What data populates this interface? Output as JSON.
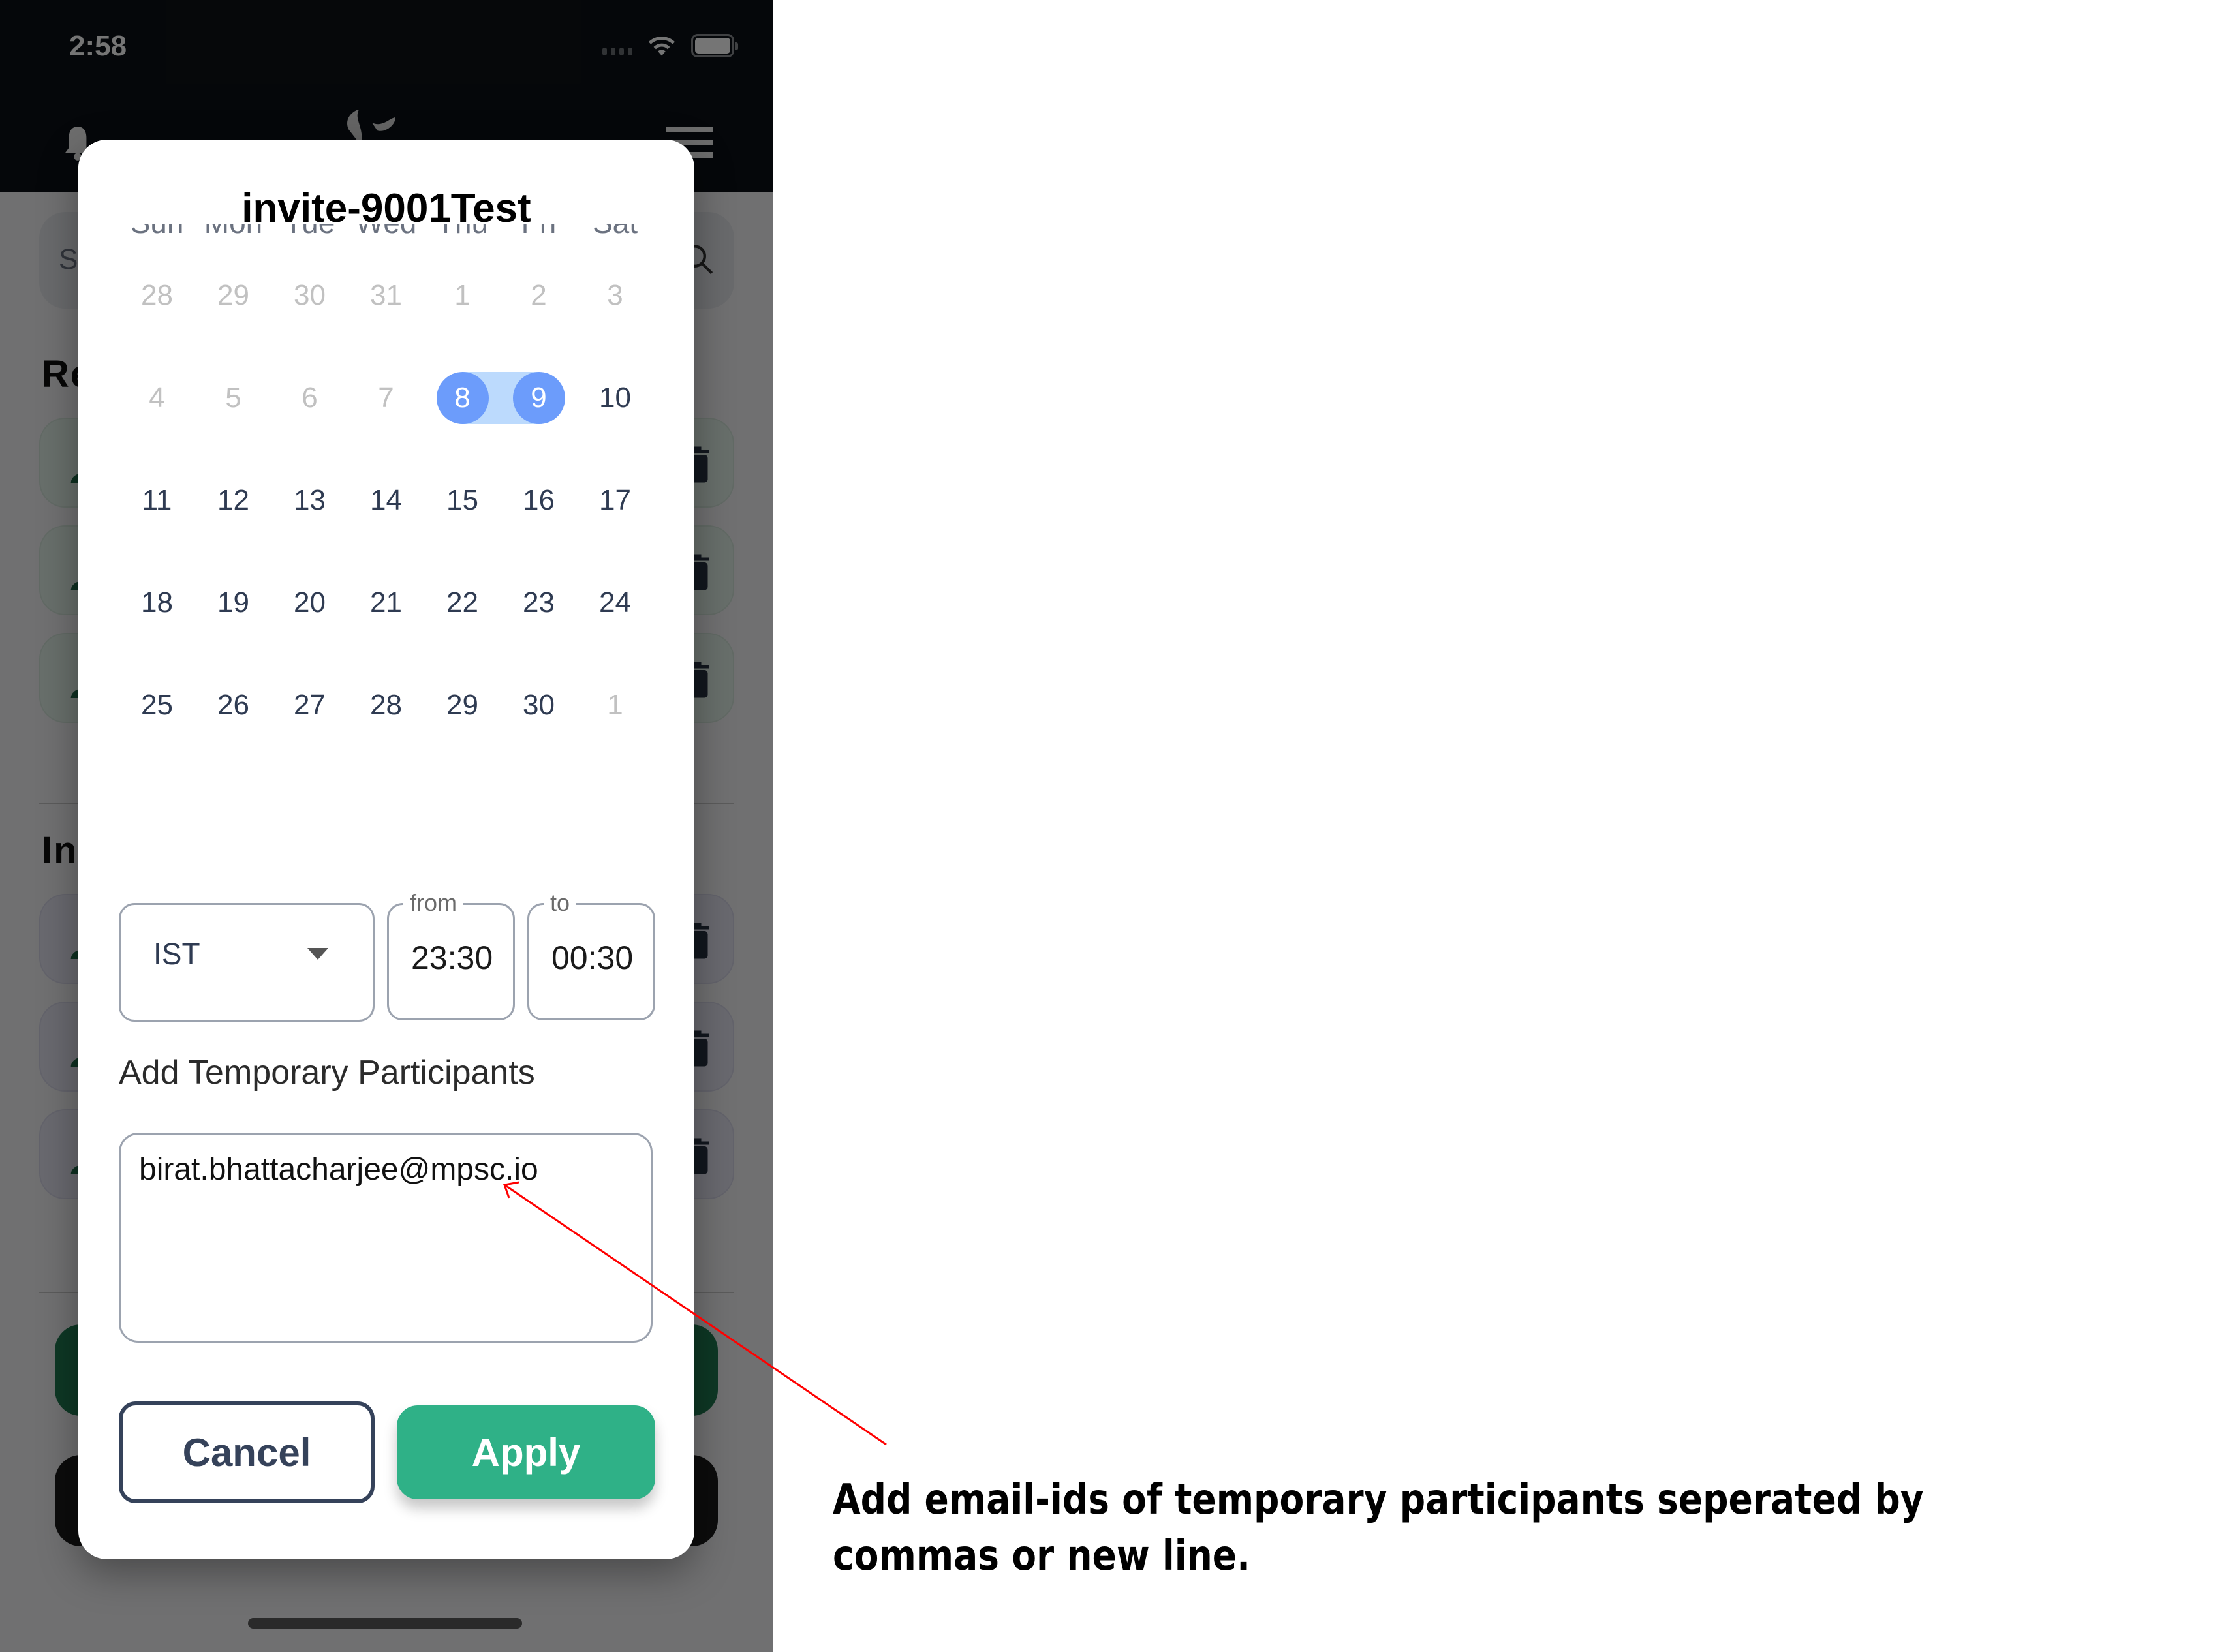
{
  "status_bar": {
    "time": "2:58"
  },
  "app_header": {
    "logo": "app-logo",
    "left_icon": "bell-icon",
    "right_icon": "menu-icon"
  },
  "background": {
    "search_placeholder": "S",
    "section_1_title": "Re",
    "section_2_title": "In"
  },
  "dialog": {
    "title": "invite-9001Test",
    "weekdays": [
      "Sun",
      "Mon",
      "Tue",
      "Wed",
      "Thu",
      "Fri",
      "Sat"
    ],
    "calendar_weeks": [
      [
        {
          "d": "28",
          "muted": true
        },
        {
          "d": "29",
          "muted": true
        },
        {
          "d": "30",
          "muted": true
        },
        {
          "d": "31",
          "muted": true
        },
        {
          "d": "1",
          "muted": true
        },
        {
          "d": "2",
          "muted": true
        },
        {
          "d": "3",
          "muted": true
        }
      ],
      [
        {
          "d": "4",
          "muted": true
        },
        {
          "d": "5",
          "muted": true
        },
        {
          "d": "6",
          "muted": true
        },
        {
          "d": "7",
          "muted": true
        },
        {
          "d": "8",
          "selected": true
        },
        {
          "d": "9",
          "selected": true
        },
        {
          "d": "10"
        }
      ],
      [
        {
          "d": "11"
        },
        {
          "d": "12"
        },
        {
          "d": "13"
        },
        {
          "d": "14"
        },
        {
          "d": "15"
        },
        {
          "d": "16"
        },
        {
          "d": "17"
        }
      ],
      [
        {
          "d": "18"
        },
        {
          "d": "19"
        },
        {
          "d": "20"
        },
        {
          "d": "21"
        },
        {
          "d": "22"
        },
        {
          "d": "23"
        },
        {
          "d": "24"
        }
      ],
      [
        {
          "d": "25"
        },
        {
          "d": "26"
        },
        {
          "d": "27"
        },
        {
          "d": "28"
        },
        {
          "d": "29"
        },
        {
          "d": "30"
        },
        {
          "d": "1",
          "muted": true
        }
      ]
    ],
    "selected_range": {
      "start": "8",
      "end": "9"
    },
    "timezone": {
      "value": "IST"
    },
    "from": {
      "label": "from",
      "value": "23:30"
    },
    "to": {
      "label": "to",
      "value": "00:30"
    },
    "participants_label": "Add Temporary Participants",
    "participants_value": "birat.bhattacharjee@mpsc.io",
    "cancel_label": "Cancel",
    "apply_label": "Apply"
  },
  "annotation": {
    "text": "Add email-ids of temporary participants seperated by commas or new line."
  },
  "colors": {
    "accent_green": "#2fb187",
    "selected_day": "#6c9cfb",
    "range_band": "#bcdafd",
    "annotation_arrow": "#ff0000"
  }
}
